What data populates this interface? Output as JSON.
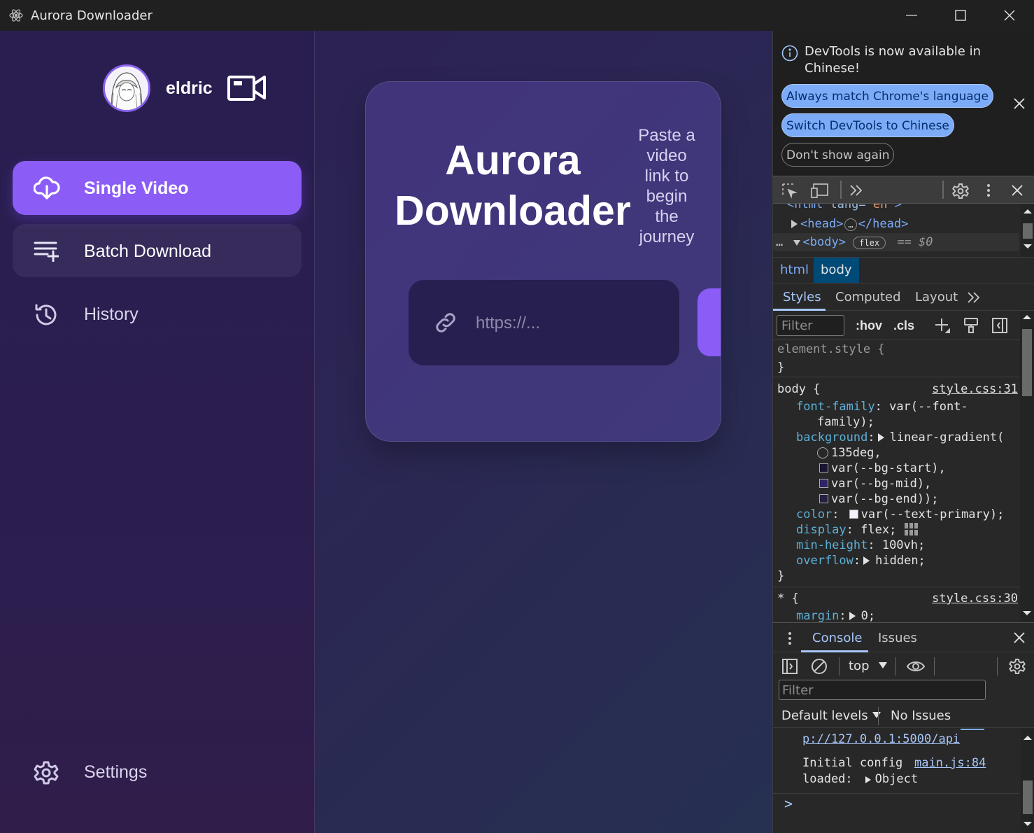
{
  "window": {
    "title": "Aurora Downloader",
    "icon": "electron-atom-icon",
    "controls": [
      "minimize",
      "maximize",
      "close"
    ]
  },
  "sidebar": {
    "username": "eldric",
    "nav": {
      "single": {
        "label": "Single Video",
        "icon": "cloud-download-icon",
        "active": true
      },
      "batch": {
        "label": "Batch Download",
        "icon": "playlist-add-icon"
      },
      "history": {
        "label": "History",
        "icon": "history-icon"
      },
      "settings": {
        "label": "Settings",
        "icon": "gear-icon"
      }
    }
  },
  "main": {
    "title_line1": "Aurora",
    "title_line2": "Downloader",
    "tagline": [
      "Paste a",
      "video",
      "link to",
      "begin",
      "the",
      "journey"
    ],
    "url_placeholder": "https://..."
  },
  "devtools": {
    "notice": {
      "message": "DevTools is now available in Chinese!",
      "btn_match": "Always match Chrome's language",
      "btn_switch": "Switch DevTools to Chinese",
      "btn_dismiss": "Don't show again"
    },
    "elements": {
      "row0_tag": "<html",
      "row0_attr": " lang=",
      "row0_val": "\"en\"",
      "row0_close": ">",
      "row1": "<head>",
      "row1_close": "</head>",
      "row2": "<body>",
      "row2_badge": "flex",
      "row2_eq": "== $0"
    },
    "breadcrumbs": [
      "html",
      "body"
    ],
    "style_tabs": {
      "styles": "Styles",
      "computed": "Computed",
      "layout": "Layout"
    },
    "filter_placeholder": "Filter",
    "hov": ":hov",
    "cls": ".cls",
    "styles": {
      "element_style": "element.style {",
      "close": "}",
      "body_selector": "body {",
      "body_source": "style.css:31",
      "p_font_family": "font-family",
      "v_font_family_1": "var(--font-",
      "v_font_family_2": "family);",
      "p_background": "background",
      "v_bg_fn": "linear-gradient(",
      "v_bg_angle": "135deg,",
      "v_bg_start": "var(--bg-start),",
      "v_bg_mid": "var(--bg-mid),",
      "v_bg_end": "var(--bg-end));",
      "p_color": "color",
      "v_color": "var(--text-primary);",
      "p_display": "display",
      "v_display": "flex;",
      "p_min_height": "min-height",
      "v_min_height": "100vh;",
      "p_overflow": "overflow",
      "v_overflow": "hidden;",
      "star_selector": "* {",
      "star_source": "style.css:30",
      "p_margin": "margin",
      "v_margin": "0;"
    },
    "console_tabs": {
      "console": "Console",
      "issues": "Issues"
    },
    "console_context": "top",
    "console_filter": "Filter",
    "levels": "Default levels",
    "issues": "No Issues",
    "console": {
      "link_api": "p://127.0.0.1:5000/api",
      "log_text_1": "Initial config",
      "log_text_2": "loaded:",
      "log_source": "main.js:84",
      "log_object": "Object",
      "prompt": ">"
    }
  },
  "colors": {
    "accent": "#8b5cf6",
    "devtools_bg": "#282828",
    "devtools_pill": "#7cacf8"
  }
}
